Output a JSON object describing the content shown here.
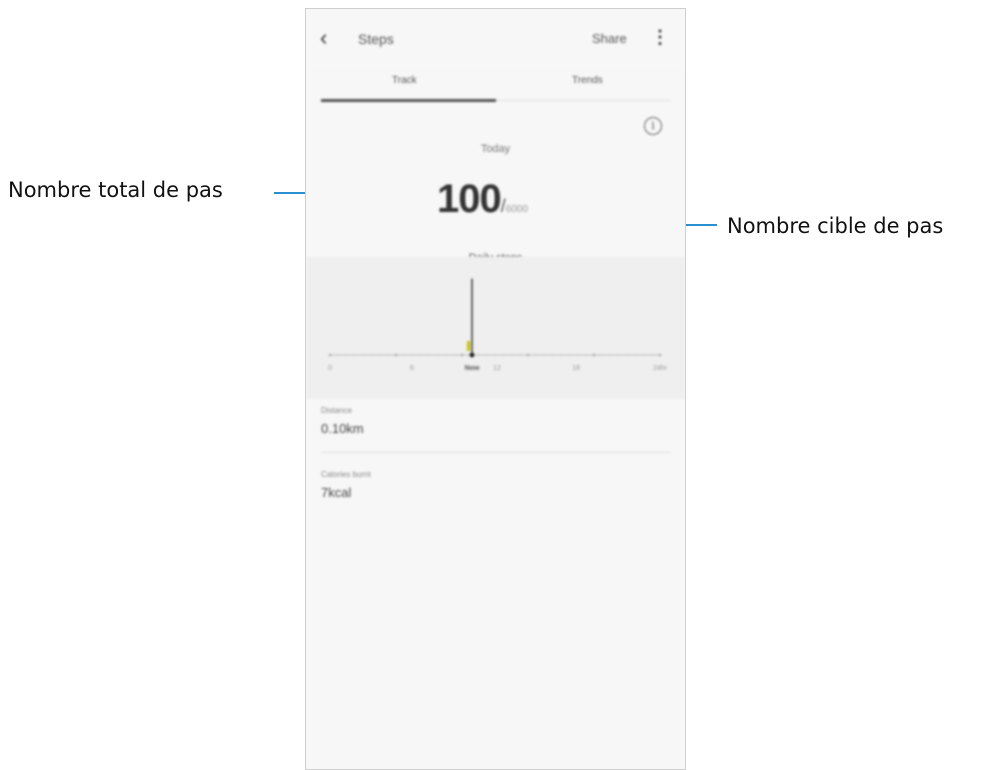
{
  "callouts": {
    "left": "Nombre total de pas",
    "right": "Nombre cible de pas"
  },
  "appbar": {
    "back_icon": "chevron-left-icon",
    "title": "Steps",
    "share_label": "Share",
    "more_icon": "more-vertical-icon"
  },
  "tabs": [
    {
      "label": "Track",
      "selected": true
    },
    {
      "label": "Trends",
      "selected": false
    }
  ],
  "summary": {
    "info_icon": "info-icon",
    "day_label": "Today",
    "steps_value": "100",
    "separator": "/",
    "goal_value": "6000",
    "caption": "Daily steps"
  },
  "chart_data": {
    "type": "bar",
    "x": [
      "0",
      "6",
      "Now",
      "12",
      "18",
      "24"
    ],
    "ticks": [
      "0",
      "6",
      "Now",
      "12",
      "18",
      "24hr"
    ],
    "series": [
      {
        "values": [
          0,
          0,
          100,
          0,
          0,
          0
        ]
      }
    ],
    "marker_label": "Now",
    "ylim": [
      0,
      110
    ],
    "grid": false
  },
  "stats": [
    {
      "label": "Distance",
      "value": "0.10km"
    },
    {
      "label": "Calories burnt",
      "value": "7kcal"
    }
  ],
  "colors": {
    "accent_line": "#2a8fd1",
    "bar": "#444444",
    "marker": "#c9c000"
  }
}
